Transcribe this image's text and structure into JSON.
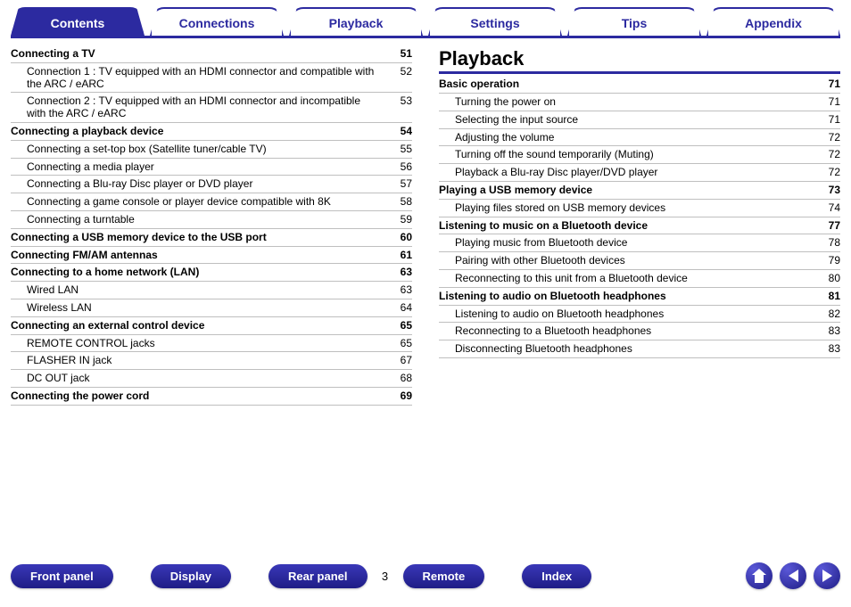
{
  "tabs": [
    {
      "label": "Contents",
      "active": true
    },
    {
      "label": "Connections"
    },
    {
      "label": "Playback"
    },
    {
      "label": "Settings"
    },
    {
      "label": "Tips"
    },
    {
      "label": "Appendix"
    }
  ],
  "left_column": [
    {
      "type": "head",
      "title": "Connecting a TV",
      "page": "51"
    },
    {
      "type": "sub",
      "title": "Connection 1 : TV equipped with an HDMI connector and compatible with the ARC / eARC",
      "page": "52"
    },
    {
      "type": "sub",
      "title": "Connection 2 : TV equipped with an HDMI connector and incompatible with the ARC / eARC",
      "page": "53"
    },
    {
      "type": "head",
      "title": "Connecting a playback device",
      "page": "54"
    },
    {
      "type": "sub",
      "title": "Connecting a set-top box (Satellite tuner/cable TV)",
      "page": "55"
    },
    {
      "type": "sub",
      "title": "Connecting a media player",
      "page": "56"
    },
    {
      "type": "sub",
      "title": "Connecting a Blu-ray Disc player or DVD player",
      "page": "57"
    },
    {
      "type": "sub",
      "title": "Connecting a game console or player device compatible with 8K",
      "page": "58"
    },
    {
      "type": "sub",
      "title": "Connecting a turntable",
      "page": "59"
    },
    {
      "type": "head",
      "title": "Connecting a USB memory device to the USB port",
      "page": "60"
    },
    {
      "type": "head",
      "title": "Connecting FM/AM antennas",
      "page": "61"
    },
    {
      "type": "head",
      "title": "Connecting to a home network (LAN)",
      "page": "63"
    },
    {
      "type": "sub",
      "title": "Wired LAN",
      "page": "63"
    },
    {
      "type": "sub",
      "title": "Wireless LAN",
      "page": "64"
    },
    {
      "type": "head",
      "title": "Connecting an external control device",
      "page": "65"
    },
    {
      "type": "sub",
      "title": "REMOTE CONTROL jacks",
      "page": "65"
    },
    {
      "type": "sub",
      "title": "FLASHER IN jack",
      "page": "67"
    },
    {
      "type": "sub",
      "title": "DC OUT jack",
      "page": "68"
    },
    {
      "type": "head",
      "title": "Connecting the power cord",
      "page": "69"
    }
  ],
  "right_heading": "Playback",
  "right_column": [
    {
      "type": "head",
      "title": "Basic operation",
      "page": "71"
    },
    {
      "type": "sub",
      "title": "Turning the power on",
      "page": "71"
    },
    {
      "type": "sub",
      "title": "Selecting the input source",
      "page": "71"
    },
    {
      "type": "sub",
      "title": "Adjusting the volume",
      "page": "72"
    },
    {
      "type": "sub",
      "title": "Turning off the sound temporarily (Muting)",
      "page": "72"
    },
    {
      "type": "sub",
      "title": "Playback a Blu-ray Disc player/DVD player",
      "page": "72"
    },
    {
      "type": "head",
      "title": "Playing a USB memory device",
      "page": "73"
    },
    {
      "type": "sub",
      "title": "Playing files stored on USB memory devices",
      "page": "74"
    },
    {
      "type": "head",
      "title": "Listening to music on a Bluetooth device",
      "page": "77"
    },
    {
      "type": "sub",
      "title": "Playing music from Bluetooth device",
      "page": "78"
    },
    {
      "type": "sub",
      "title": "Pairing with other Bluetooth devices",
      "page": "79"
    },
    {
      "type": "sub",
      "title": "Reconnecting to this unit from a Bluetooth device",
      "page": "80"
    },
    {
      "type": "head",
      "title": "Listening to audio on Bluetooth headphones",
      "page": "81"
    },
    {
      "type": "sub",
      "title": "Listening to audio on Bluetooth headphones",
      "page": "82"
    },
    {
      "type": "sub",
      "title": "Reconnecting to a Bluetooth headphones",
      "page": "83"
    },
    {
      "type": "sub",
      "title": "Disconnecting Bluetooth headphones",
      "page": "83"
    }
  ],
  "footer": {
    "front_panel": "Front panel",
    "display": "Display",
    "rear_panel": "Rear panel",
    "remote": "Remote",
    "index": "Index",
    "page_number": "3"
  }
}
